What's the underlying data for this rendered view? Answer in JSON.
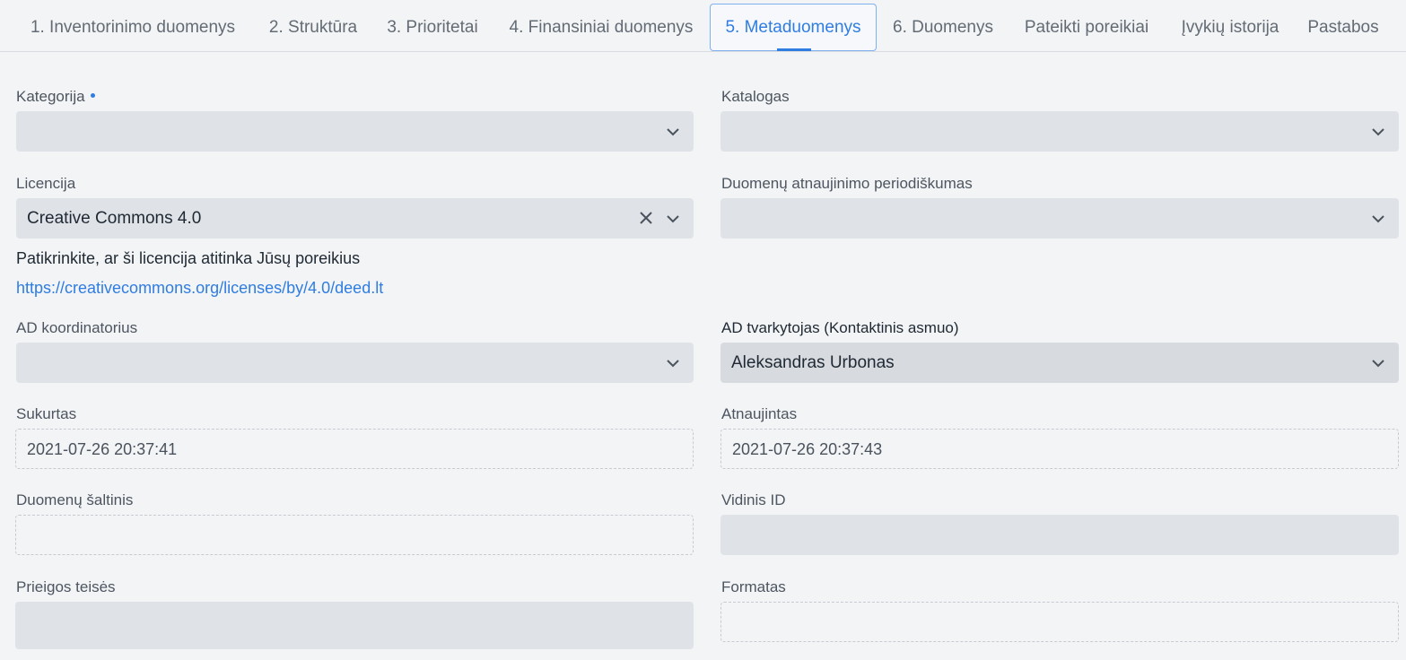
{
  "tabs": [
    {
      "label": "1. Inventorinimo duomenys"
    },
    {
      "label": "2. Struktūra"
    },
    {
      "label": "3. Prioritetai"
    },
    {
      "label": "4. Finansiniai duomenys"
    },
    {
      "label": "5. Metaduomenys"
    },
    {
      "label": "6. Duomenys"
    },
    {
      "label": "Pateikti poreikiai"
    },
    {
      "label": "Įvykių istorija"
    },
    {
      "label": "Pastabos"
    }
  ],
  "form": {
    "kategorija": {
      "label": "Kategorija",
      "value": ""
    },
    "katalogas": {
      "label": "Katalogas",
      "value": ""
    },
    "licencija": {
      "label": "Licencija",
      "value": "Creative Commons 4.0",
      "hint": "Patikrinkite, ar ši licencija atitinka Jūsų poreikius",
      "link": "https://creativecommons.org/licenses/by/4.0/deed.lt"
    },
    "periodiskumas": {
      "label": "Duomenų atnaujinimo periodiškumas",
      "value": ""
    },
    "koordinatorius": {
      "label": "AD koordinatorius",
      "value": ""
    },
    "tvarkytojas": {
      "label": "AD tvarkytojas (Kontaktinis asmuo)",
      "value": "Aleksandras Urbonas"
    },
    "sukurtas": {
      "label": "Sukurtas",
      "value": "2021-07-26 20:37:41"
    },
    "atnaujintas": {
      "label": "Atnaujintas",
      "value": "2021-07-26 20:37:43"
    },
    "saltinis": {
      "label": "Duomenų šaltinis",
      "value": ""
    },
    "vidinis_id": {
      "label": "Vidinis ID",
      "value": ""
    },
    "prieigos": {
      "label": "Prieigos teisės",
      "value": ""
    },
    "formatas": {
      "label": "Formatas",
      "value": ""
    }
  },
  "icons": {
    "dropdown": "chevron-down-icon",
    "clear": "close-icon"
  },
  "colors": {
    "accent": "#2f7de0",
    "field_bg": "#dfe2e7",
    "page_bg": "#f3f4f6"
  }
}
